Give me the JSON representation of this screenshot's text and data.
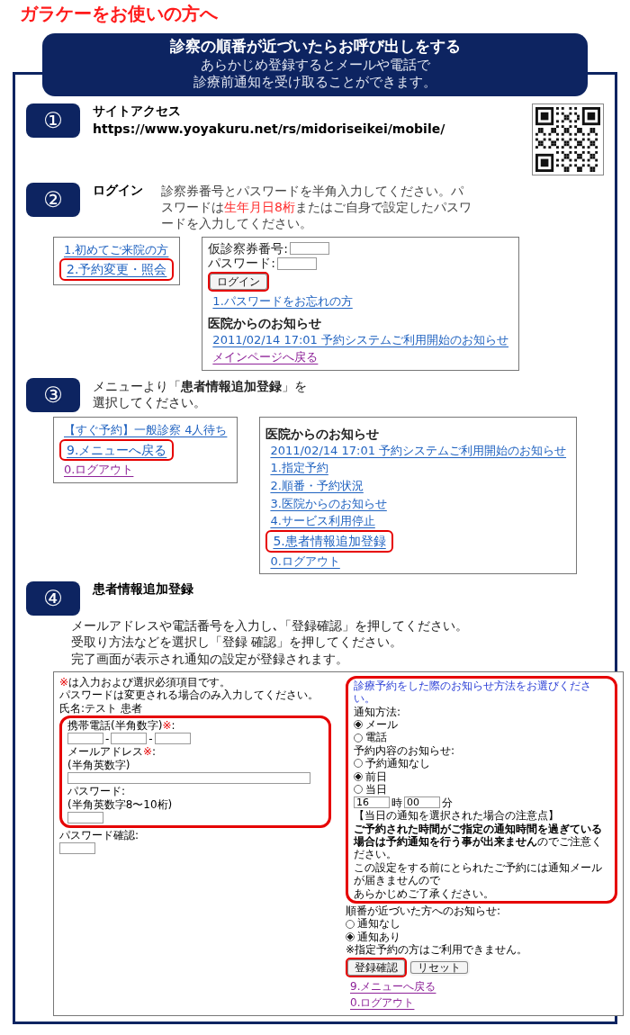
{
  "page_title": "ガラケーをお使いの方へ",
  "banner": {
    "title": "診察の順番が近づいたらお呼び出しをする",
    "lines": [
      "あらかじめ登録するとメールや電話で",
      "診療前通知を受け取ることができます。"
    ]
  },
  "steps": [
    {
      "number": "①",
      "title": "サイトアクセス",
      "url": "https://www.yoyakuru.net/rs/midoriseikei/mobile/",
      "has_qr_code": true
    },
    {
      "number": "②",
      "title": "ログイン",
      "text_parts": [
        {
          "text": "診察券番号とパスワードを半角入力してください。パスワードは",
          "red": false
        },
        {
          "text": "生年月日8桁",
          "red": true
        },
        {
          "text": "またはご自身で設定したパスワードを入力してください。",
          "red": false
        }
      ],
      "screens": [
        {
          "kind": "menu",
          "items": [
            {
              "kind": "link",
              "text": "1.初めてご来院の方",
              "visited": false,
              "highlighted": false
            },
            {
              "kind": "link",
              "text": "2.予約変更・照会",
              "visited": false,
              "highlighted": true
            }
          ]
        },
        {
          "kind": "menu",
          "items": [
            {
              "kind": "row",
              "children": [
                {
                  "kind": "text",
                  "parts": [
                    {
                      "text": "仮診察券番号:",
                      "kind": "plain"
                    }
                  ]
                },
                {
                  "kind": "input"
                }
              ]
            },
            {
              "kind": "row",
              "children": [
                {
                  "kind": "text",
                  "parts": [
                    {
                      "text": "パスワード:",
                      "kind": "plain"
                    }
                  ]
                },
                {
                  "kind": "input"
                }
              ]
            },
            {
              "kind": "button",
              "text": "ログイン",
              "highlighted": true
            },
            {
              "kind": "link",
              "text": "1.パスワードをお忘れの方",
              "visited": false,
              "highlighted": false
            },
            {
              "kind": "heading",
              "text": "医院からのお知らせ"
            },
            {
              "kind": "link",
              "text": "2011/02/14 17:01 予約システムご利用開始のお知らせ",
              "visited": false,
              "highlighted": false
            },
            {
              "kind": "link",
              "text": "メインページへ戻る",
              "visited": true,
              "highlighted": false
            }
          ]
        }
      ]
    },
    {
      "number": "③",
      "text": "メニューより「**患者情報追加登録**」を選択してください。",
      "screens": [
        {
          "kind": "menu",
          "items": [
            {
              "kind": "link",
              "text": "【すぐ予約】一般診察 4人待ち",
              "visited": false,
              "highlighted": false
            },
            {
              "kind": "link",
              "text": "9.メニューへ戻る",
              "visited": false,
              "highlighted": true
            },
            {
              "kind": "link",
              "text": "0.ログアウト",
              "visited": true,
              "highlighted": false
            }
          ]
        },
        {
          "kind": "menu",
          "items": [
            {
              "kind": "heading",
              "text": "医院からのお知らせ"
            },
            {
              "kind": "link",
              "text": "2011/02/14 17:01 予約システムご利用開始のお知らせ",
              "visited": false,
              "highlighted": false
            },
            {
              "kind": "link",
              "text": "1.指定予約",
              "visited": false,
              "highlighted": false
            },
            {
              "kind": "link",
              "text": "2.順番・予約状況",
              "visited": false,
              "highlighted": false
            },
            {
              "kind": "link",
              "text": "3.医院からのお知らせ",
              "visited": false,
              "highlighted": false
            },
            {
              "kind": "link",
              "text": "4.サービス利用停止",
              "visited": false,
              "highlighted": false
            },
            {
              "kind": "link",
              "text": "5.患者情報追加登録",
              "visited": false,
              "highlighted": true
            },
            {
              "kind": "link",
              "text": "0.ログアウト",
              "visited": false,
              "highlighted": false
            }
          ]
        }
      ]
    },
    {
      "number": "④",
      "title": "患者情報追加登録",
      "lines": [
        "メールアドレスや電話番号を入力し､「登録確認」を押してください。",
        "受取り方法などを選択し「登録 確認」を押してください。",
        "完了画面が表示され通知の設定が登録されます。"
      ],
      "screens": [
        {
          "kind": "form",
          "items": [
            {
              "kind": "text",
              "parts": [
                {
                  "text": "※",
                  "kind": "red"
                },
                {
                  "text": "は入力および選択必須項目です。",
                  "kind": "plain"
                }
              ]
            },
            {
              "kind": "text",
              "parts": [
                {
                  "text": "パスワードは変更される場合のみ入力してください。",
                  "kind": "plain"
                }
              ]
            },
            {
              "kind": "text",
              "parts": [
                {
                  "text": "氏名:テスト 患者",
                  "kind": "plain"
                }
              ]
            },
            {
              "kind": "group",
              "highlighted": true,
              "children": [
                {
                  "kind": "text",
                  "parts": [
                    {
                      "text": "携帯電話(半角数字)",
                      "kind": "plain"
                    },
                    {
                      "text": "※",
                      "kind": "red"
                    },
                    {
                      "text": ":",
                      "kind": "plain"
                    }
                  ]
                },
                {
                  "kind": "row",
                  "children": [
                    {
                      "kind": "input"
                    },
                    {
                      "kind": "text",
                      "parts": [
                        {
                          "text": "-",
                          "kind": "plain"
                        }
                      ]
                    },
                    {
                      "kind": "input"
                    },
                    {
                      "kind": "text",
                      "parts": [
                        {
                          "text": "-",
                          "kind": "plain"
                        }
                      ]
                    },
                    {
                      "kind": "input"
                    }
                  ]
                },
                {
                  "kind": "text",
                  "parts": [
                    {
                      "text": "メールアドレス",
                      "kind": "plain"
                    },
                    {
                      "text": "※",
                      "kind": "red"
                    },
                    {
                      "text": ":",
                      "kind": "plain"
                    }
                  ]
                },
                {
                  "kind": "text",
                  "parts": [
                    {
                      "text": "(半角英数字)",
                      "kind": "plain"
                    }
                  ]
                },
                {
                  "kind": "long_input"
                },
                {
                  "kind": "text",
                  "parts": [
                    {
                      "text": "パスワード:",
                      "kind": "plain"
                    }
                  ]
                },
                {
                  "kind": "text",
                  "parts": [
                    {
                      "text": "(半角英数字8〜10桁)",
                      "kind": "plain"
                    }
                  ]
                },
                {
                  "kind": "input"
                }
              ]
            },
            {
              "kind": "text",
              "parts": [
                {
                  "text": "パスワード確認:",
                  "kind": "plain"
                }
              ]
            },
            {
              "kind": "input"
            },
            {
              "kind": "group",
              "highlighted": true,
              "children": [
                {
                  "kind": "text",
                  "parts": [
                    {
                      "text": "診療予約をした際のお知らせ方法をお選びください。",
                      "kind": "blue"
                    }
                  ]
                },
                {
                  "kind": "text",
                  "parts": [
                    {
                      "text": "通知方法:",
                      "kind": "plain"
                    }
                  ]
                },
                {
                  "kind": "radio",
                  "text": "メール",
                  "selected": true
                },
                {
                  "kind": "radio",
                  "text": "電話",
                  "selected": false
                },
                {
                  "kind": "text",
                  "parts": [
                    {
                      "text": "予約内容のお知らせ:",
                      "kind": "plain"
                    }
                  ]
                },
                {
                  "kind": "radio",
                  "text": "予約通知なし",
                  "selected": false
                },
                {
                  "kind": "radio",
                  "text": "前日",
                  "selected": true
                },
                {
                  "kind": "radio",
                  "text": "当日",
                  "selected": false
                },
                {
                  "kind": "row",
                  "children": [
                    {
                      "kind": "input",
                      "value": "16"
                    },
                    {
                      "kind": "text",
                      "parts": [
                        {
                          "text": "時",
                          "kind": "plain"
                        }
                      ]
                    },
                    {
                      "kind": "input",
                      "value": "00"
                    },
                    {
                      "kind": "text",
                      "parts": [
                        {
                          "text": "分",
                          "kind": "plain"
                        }
                      ]
                    }
                  ]
                },
                {
                  "kind": "text",
                  "parts": [
                    {
                      "text": "【当日の通知を選択された場合の注意点】",
                      "kind": "plain"
                    }
                  ]
                },
                {
                  "kind": "text",
                  "parts": [
                    {
                      "text": "ご予約された時間がご指定の通知時間を過ぎている場合は予約通知を行う事が出来ません",
                      "kind": "bold"
                    },
                    {
                      "text": "のでご注意ください。",
                      "kind": "plain"
                    }
                  ]
                },
                {
                  "kind": "text",
                  "parts": [
                    {
                      "text": "この設定をする前にとられたご予約には通知メールが届きませんので",
                      "kind": "plain"
                    }
                  ]
                },
                {
                  "kind": "text",
                  "parts": [
                    {
                      "text": "あらかじめご了承ください。",
                      "kind": "plain"
                    }
                  ]
                }
              ]
            },
            {
              "kind": "text",
              "parts": [
                {
                  "text": "順番が近づいた方へのお知らせ:",
                  "kind": "plain"
                }
              ]
            },
            {
              "kind": "radio",
              "text": "通知なし",
              "selected": false
            },
            {
              "kind": "radio",
              "text": "通知あり",
              "selected": true
            },
            {
              "kind": "text",
              "parts": [
                {
                  "text": "※指定予約の方はご利用できません。",
                  "kind": "plain"
                }
              ]
            },
            {
              "kind": "row",
              "children": [
                {
                  "kind": "button",
                  "text": "登録確認",
                  "highlighted": true
                },
                {
                  "kind": "button",
                  "text": "リセット",
                  "highlighted": false
                }
              ]
            },
            {
              "kind": "link",
              "text": "9.メニューへ戻る",
              "visited": true,
              "highlighted": false
            },
            {
              "kind": "link",
              "text": "0.ログアウト",
              "visited": true,
              "highlighted": false
            }
          ]
        }
      ]
    }
  ]
}
